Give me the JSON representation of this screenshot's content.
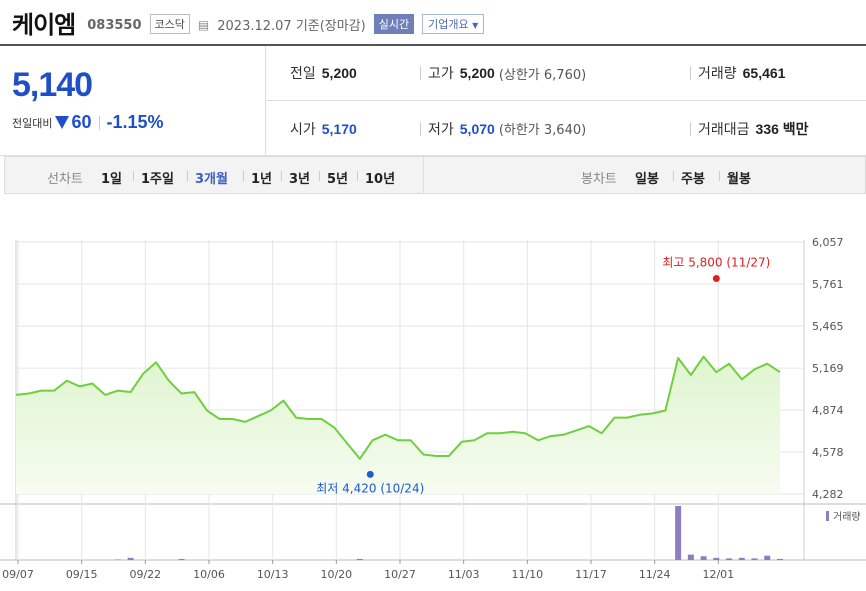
{
  "header": {
    "stock_name": "케이엠",
    "stock_code": "083550",
    "market": "코스닥",
    "date_text": "2023.12.07  기준(장마감)",
    "realtime_label": "실시간",
    "company_label": "기업개요"
  },
  "price": {
    "current": "5,140",
    "change_label": "전일대비",
    "change_value": "60",
    "change_pct": "-1.15%"
  },
  "stats": {
    "prev_close_label": "전일",
    "prev_close": "5,200",
    "high_label": "고가",
    "high": "5,200",
    "high_sub": "(상한가 6,760)",
    "volume_label": "거래량",
    "volume": "65,461",
    "open_label": "시가",
    "open": "5,170",
    "low_label": "저가",
    "low": "5,070",
    "low_sub": "(하한가 3,640)",
    "amount_label": "거래대금",
    "amount": "336 백만"
  },
  "periods": {
    "line_label": "선차트",
    "line_items": [
      "1일",
      "1주일",
      "3개월",
      "1년",
      "3년",
      "5년",
      "10년"
    ],
    "active": "3개월",
    "candle_label": "봉차트",
    "candle_items": [
      "일봉",
      "주봉",
      "월봉"
    ]
  },
  "colors": {
    "price_blue": "#1e4fc8",
    "line_green": "#6fcf3f",
    "fill_green": "#dff5cf",
    "high_red": "#e02020",
    "low_blue": "#1e5ad0",
    "volume_purple": "#8b7fc2"
  },
  "chart_data": {
    "type": "area",
    "y_ticks": [
      "6,057",
      "5,761",
      "5,465",
      "5,169",
      "4,874",
      "4,578",
      "4,282"
    ],
    "ylim": [
      4282,
      6057
    ],
    "x_labels": [
      "09/07",
      "09/15",
      "09/22",
      "10/06",
      "10/13",
      "10/20",
      "10/27",
      "11/03",
      "11/10",
      "11/17",
      "11/24",
      "12/01"
    ],
    "prices": [
      4980,
      4990,
      5010,
      5010,
      5080,
      5040,
      5060,
      4980,
      5010,
      5000,
      5130,
      5210,
      5080,
      4990,
      5000,
      4870,
      4810,
      4810,
      4790,
      4830,
      4870,
      4940,
      4820,
      4810,
      4810,
      4750,
      4640,
      4530,
      4660,
      4700,
      4660,
      4660,
      4560,
      4550,
      4550,
      4650,
      4660,
      4710,
      4710,
      4720,
      4710,
      4660,
      4690,
      4700,
      4730,
      4760,
      4710,
      4820,
      4820,
      4840,
      4850,
      4870,
      5240,
      5120,
      5250,
      5140,
      5200,
      5090,
      5160,
      5200,
      5140
    ],
    "volume": [
      0,
      0,
      0,
      0,
      0,
      0,
      0,
      0,
      1,
      4,
      0,
      0,
      0,
      2,
      0,
      0,
      0,
      0,
      0,
      0,
      0,
      0,
      0,
      0,
      0,
      0,
      0,
      2,
      0,
      0,
      0,
      0,
      0,
      0,
      0,
      0,
      0,
      0,
      0,
      0,
      0,
      0,
      0,
      0,
      0,
      0,
      0,
      0,
      0,
      0,
      0,
      0,
      100,
      10,
      7,
      4,
      3,
      4,
      3,
      8,
      2
    ],
    "high_annotation": "최고 5,800 (11/27)",
    "high_value": 5800,
    "high_index": 55,
    "low_annotation": "최저 4,420 (10/24)",
    "low_value": 4420,
    "low_index": 29,
    "volume_legend": "거래량"
  }
}
